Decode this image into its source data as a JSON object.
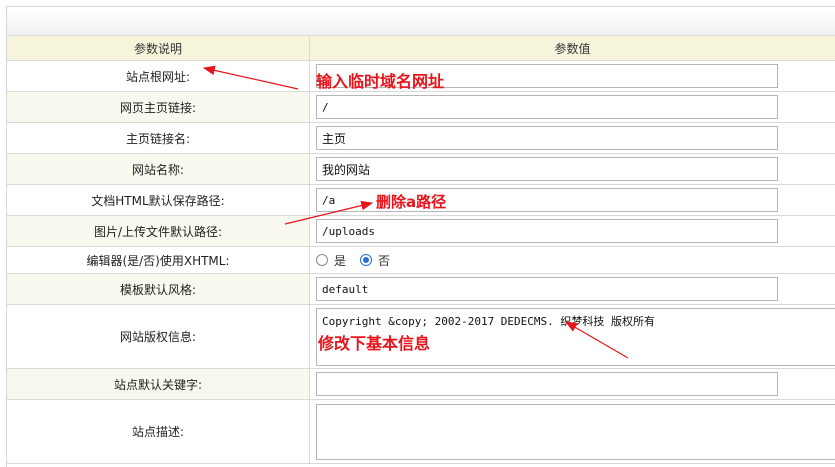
{
  "table": {
    "header_label": "参数说明",
    "header_value": "参数值"
  },
  "fields": {
    "site_root_url": {
      "label": "站点根网址:",
      "value": ""
    },
    "home_link": {
      "label": "网页主页链接:",
      "value": "/"
    },
    "home_link_name": {
      "label": "主页链接名:",
      "value": "主页"
    },
    "site_name": {
      "label": "网站名称:",
      "value": "我的网站"
    },
    "html_save_path": {
      "label": "文档HTML默认保存路径:",
      "value": "/a"
    },
    "upload_path": {
      "label": "图片/上传文件默认路径:",
      "value": "/uploads"
    },
    "editor_xhtml": {
      "label": "编辑器(是/否)使用XHTML:",
      "options": [
        "是",
        "否"
      ],
      "selected": "否"
    },
    "template_style": {
      "label": "模板默认风格:",
      "value": "default"
    },
    "copyright": {
      "label": "网站版权信息:",
      "value": "Copyright &copy; 2002-2017 DEDECMS. 织梦科技 版权所有"
    },
    "keywords": {
      "label": "站点默认关键字:",
      "value": ""
    },
    "description": {
      "label": "站点描述:",
      "value": ""
    }
  },
  "annotations": {
    "temp_domain": "输入临时域名网址",
    "delete_a": "删除a路径",
    "edit_info": "修改下基本信息"
  },
  "colors": {
    "annotation_red": "#e8141b",
    "header_bg": "#f6f5dc",
    "radio_blue": "#2b6fd6"
  }
}
